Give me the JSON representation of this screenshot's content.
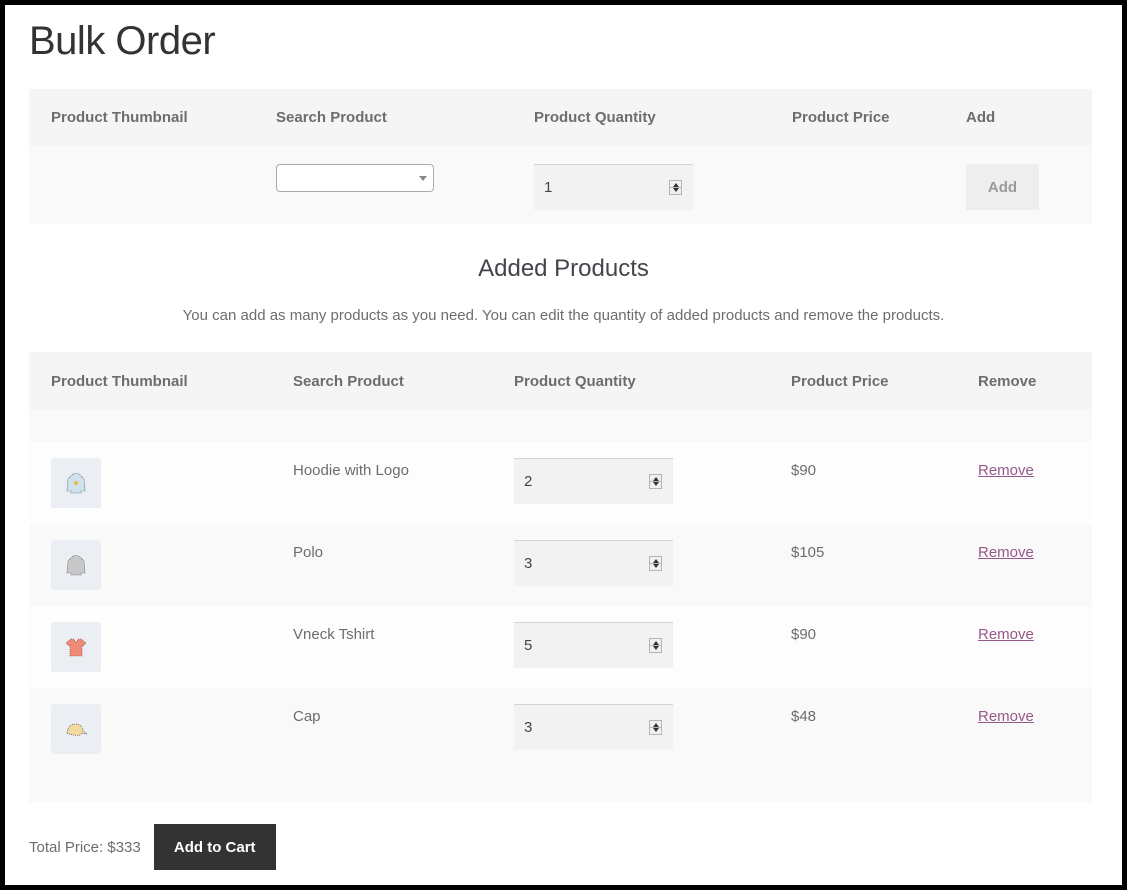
{
  "page": {
    "title": "Bulk Order"
  },
  "bulk_table": {
    "headers": [
      "Product Thumbnail",
      "Search Product",
      "Product Quantity",
      "Product Price",
      "Add"
    ],
    "search_select_value": "",
    "quantity": "1",
    "price": "",
    "add_label": "Add"
  },
  "added": {
    "title": "Added Products",
    "description": "You can add as many products as you need. You can edit the quantity of added products and remove the products.",
    "headers": [
      "Product Thumbnail",
      "Search Product",
      "Product Quantity",
      "Product Price",
      "Remove"
    ],
    "rows": [
      {
        "name": "Hoodie with Logo",
        "quantity": "2",
        "price": "$90",
        "remove_label": "Remove",
        "thumb": "hoodie-with-logo",
        "color": "#cfe3ee"
      },
      {
        "name": "Polo",
        "quantity": "3",
        "price": "$105",
        "remove_label": "Remove",
        "thumb": "polo",
        "color": "#c8c8c8"
      },
      {
        "name": "Vneck Tshirt",
        "quantity": "5",
        "price": "$90",
        "remove_label": "Remove",
        "thumb": "vneck-tshirt",
        "color": "#f08a78"
      },
      {
        "name": "Cap",
        "quantity": "3",
        "price": "$48",
        "remove_label": "Remove",
        "thumb": "cap",
        "color": "#f2d9a0"
      }
    ]
  },
  "footer": {
    "total_label": "Total Price: $333",
    "add_to_cart_label": "Add to Cart"
  },
  "colors": {
    "link": "#96588a",
    "button_dark": "#333333"
  }
}
